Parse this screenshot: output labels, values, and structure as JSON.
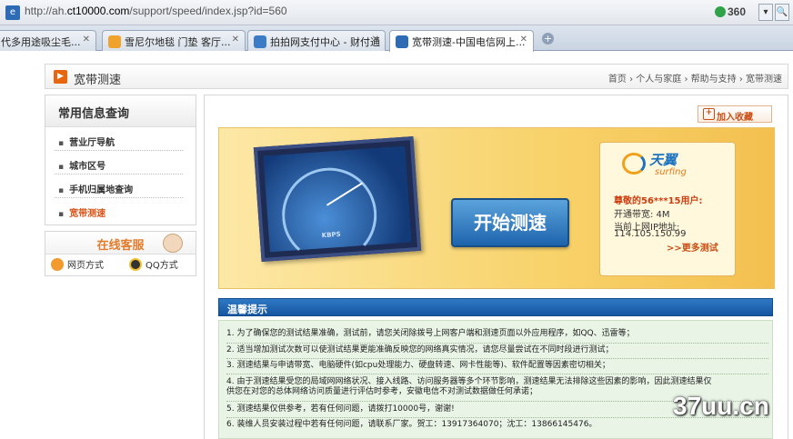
{
  "browser": {
    "url_prefix": "http://ah.",
    "url_domain": "ct10000.com",
    "url_path": "/support/speed/index.jsp?id=560",
    "security_brand": "360",
    "tabs": [
      {
        "label": "代多用途吸尘毛...",
        "color": "#7d8da6"
      },
      {
        "label": "雪尼尔地毯 门垫 客厅...",
        "color": "#f0a22a"
      },
      {
        "label": "拍拍网支付中心 - 财付通",
        "color": "#3c7cc7"
      },
      {
        "label": "宽带测速-中国电信网上...",
        "color": "#2d6bb5"
      }
    ],
    "close_glyph": "✕",
    "new_tab_glyph": "+"
  },
  "header": {
    "title": "宽带测速",
    "breadcrumb": "首页 › 个人与家庭 › 帮助与支持 › 宽带测速"
  },
  "sidebar": {
    "heading": "常用信息查询",
    "items": [
      {
        "label": "营业厅导航"
      },
      {
        "label": "城市区号"
      },
      {
        "label": "手机归属地查询"
      },
      {
        "label": "宽带测速"
      }
    ]
  },
  "service": {
    "title": "在线客服",
    "web": "网页方式",
    "qq": "QQ方式"
  },
  "main": {
    "bookmark": "加入收藏",
    "start_button": "开始测速",
    "monitor_label": "KBPS",
    "brand_cn": "天翼",
    "brand_en": "surfing",
    "greeting": "尊敬的56***15用户:",
    "bandwidth": "开通带宽: 4M",
    "ip_label": "当前上网IP地址:",
    "ip": "114.105.150.99",
    "more": ">>更多测试",
    "tips_title": "温馨提示",
    "tips": [
      "1. 为了确保您的测试结果准确，测试前，请您关闭除拨号上网客户端和测速页面以外应用程序，如QQ、迅雷等；",
      "2. 适当增加测试次数可以使测试结果更能准确反映您的网络真实情况，请您尽量尝试在不同时段进行测试；",
      "3. 测速结果与申请带宽、电脑硬件(如cpu处理能力、硬盘转速、网卡性能等)、软件配置等因素密切相关；",
      "4. 由于测速结果受您的局域网网络状况、接入线路、访问服务器等多个环节影响，测速结果无法排除这些因素的影响，因此测速结果仅",
      "供您在对您的总体网络访问质量进行评估时参考，安徽电信不对测试数据做任何承诺；",
      "5. 测速结果仅供参考，若有任何问题，请拨打10000号，谢谢!",
      "6. 装维人员安装过程中若有任何问题，请联系厂家。贺工：13917364070；沈工：13866145476。"
    ]
  },
  "watermark": "37uu.cn",
  "colors": {
    "accent": "#e8660f",
    "blue": "#1e64ad",
    "tip_bg": "#e9f4e6"
  }
}
